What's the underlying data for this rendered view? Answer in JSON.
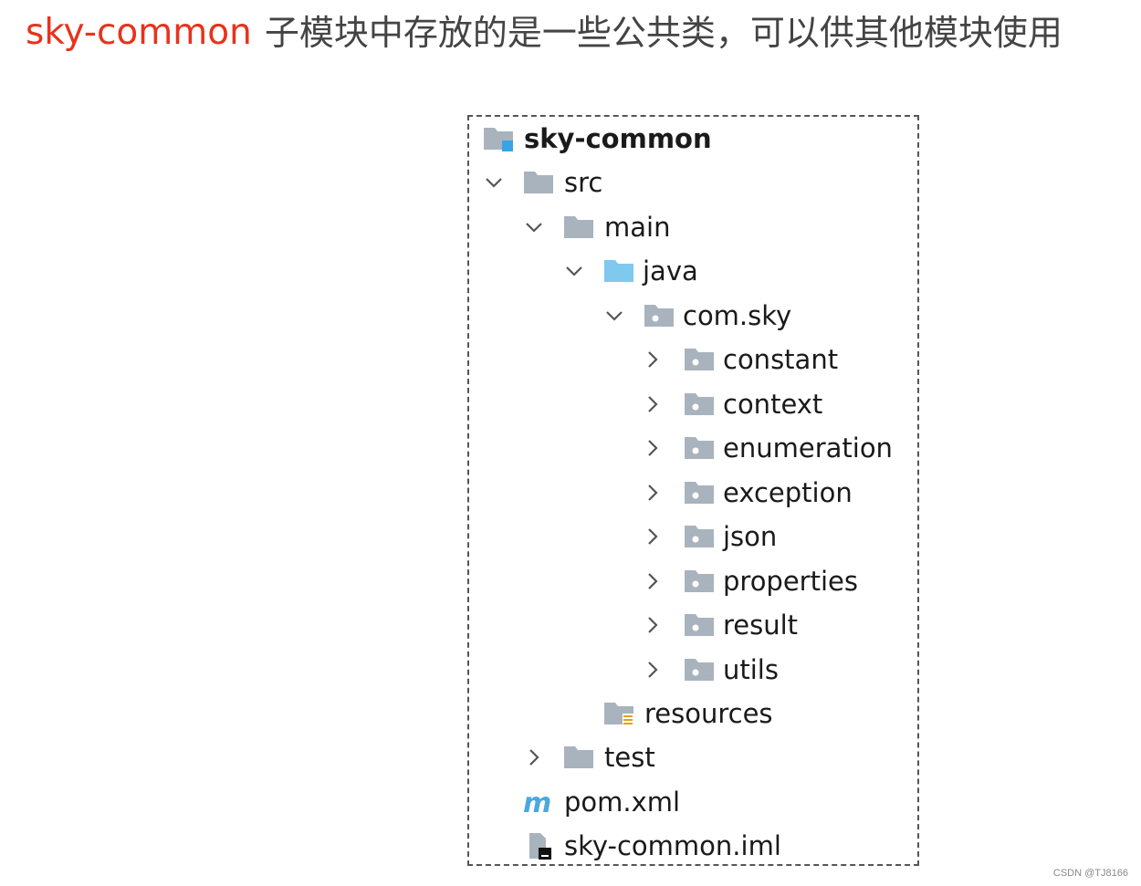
{
  "heading": {
    "module": "sky-common",
    "description": "子模块中存放的是一些公共类，可以供其他模块使用"
  },
  "colors": {
    "accent": "#e8321c",
    "folder_gray": "#a9b3bd",
    "folder_blue": "#7fc8ee",
    "module_badge": "#3aa3e3"
  },
  "tree": {
    "root": {
      "label": "sky-common",
      "icon": "module-folder-icon"
    },
    "src": {
      "label": "src",
      "icon": "folder-icon",
      "expanded": true
    },
    "main": {
      "label": "main",
      "icon": "folder-icon",
      "expanded": true
    },
    "java": {
      "label": "java",
      "icon": "source-root-folder-icon",
      "expanded": true
    },
    "package": {
      "label": "com.sky",
      "icon": "package-folder-icon",
      "expanded": true
    },
    "packages": [
      {
        "label": "constant",
        "icon": "package-folder-icon",
        "expanded": false
      },
      {
        "label": "context",
        "icon": "package-folder-icon",
        "expanded": false
      },
      {
        "label": "enumeration",
        "icon": "package-folder-icon",
        "expanded": false
      },
      {
        "label": "exception",
        "icon": "package-folder-icon",
        "expanded": false
      },
      {
        "label": "json",
        "icon": "package-folder-icon",
        "expanded": false
      },
      {
        "label": "properties",
        "icon": "package-folder-icon",
        "expanded": false
      },
      {
        "label": "result",
        "icon": "package-folder-icon",
        "expanded": false
      },
      {
        "label": "utils",
        "icon": "package-folder-icon",
        "expanded": false
      }
    ],
    "resources": {
      "label": "resources",
      "icon": "resources-folder-icon"
    },
    "test": {
      "label": "test",
      "icon": "folder-icon",
      "expanded": false
    },
    "pom": {
      "label": "pom.xml",
      "icon": "maven-icon"
    },
    "iml": {
      "label": "sky-common.iml",
      "icon": "iml-file-icon"
    }
  },
  "watermark": "CSDN @TJ8166"
}
